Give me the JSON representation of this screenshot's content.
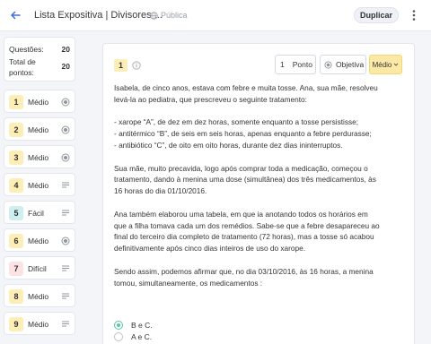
{
  "header": {
    "title": "Lista Expositiva | Divisores ...",
    "visibility": "Pública",
    "duplicate_label": "Duplicar"
  },
  "summary": {
    "questions_label": "Questões:",
    "questions_value": "20",
    "points_label": "Total de pontos:",
    "points_value": "20"
  },
  "questions": [
    {
      "number": "1",
      "difficulty": "Médio",
      "type": "objective"
    },
    {
      "number": "2",
      "difficulty": "Médio",
      "type": "objective"
    },
    {
      "number": "3",
      "difficulty": "Médio",
      "type": "objective"
    },
    {
      "number": "4",
      "difficulty": "Médio",
      "type": "discursive"
    },
    {
      "number": "5",
      "difficulty": "Fácil",
      "type": "discursive"
    },
    {
      "number": "6",
      "difficulty": "Médio",
      "type": "objective"
    },
    {
      "number": "7",
      "difficulty": "Difícil",
      "type": "discursive"
    },
    {
      "number": "8",
      "difficulty": "Médio",
      "type": "discursive"
    },
    {
      "number": "9",
      "difficulty": "Médio",
      "type": "discursive"
    }
  ],
  "colors": {
    "accent": "#3b6fd8",
    "medio": "#fdeeb8",
    "facil": "#cfeef0",
    "dificil": "#fbe3e3",
    "selected_radio": "#5ac8a0"
  },
  "editor": {
    "number": "1",
    "points_value": "1",
    "points_label": "Ponto",
    "type_label": "Objetiva",
    "difficulty_label": "Médio",
    "statement": [
      "Isabela, de cinco anos, estava com febre e muita tosse. Ana, sua mãe, resolveu levá-la ao pediatra, que prescreveu o seguinte tratamento:",
      "",
      "- xarope “A”, de dez em dez horas, somente enquanto a tosse persistisse;",
      "- antitérmico “B”, de seis em seis horas, apenas enquanto a febre perdurasse;",
      "- antibiótico “C”, de oito em oito horas, durante dez dias ininterruptos.",
      "",
      "Sua mãe, muito precavida, logo após comprar toda a medicação, começou o tratamento, dando à menina uma dose (simultânea) dos três medicamentos, às 16 horas do dia 01/10/2016.",
      "",
      "Ana também elaborou uma tabela, em que ia anotando todos os horários em que a filha tomava cada um dos remédios. Sabe-se que a febre desapareceu ao final do terceiro dia completo de tratamento (72 horas), mas a tosse só acabou definitivamente após cinco dias inteiros de uso do xarope.",
      "",
      "Sendo assim, podemos afirmar que, no dia 03/10/2016, às 16 horas, a menina tomou, simultaneamente, os medicamentos :"
    ],
    "options": [
      {
        "label": "B e C.",
        "selected": true
      },
      {
        "label": "A e C.",
        "selected": false
      }
    ]
  }
}
